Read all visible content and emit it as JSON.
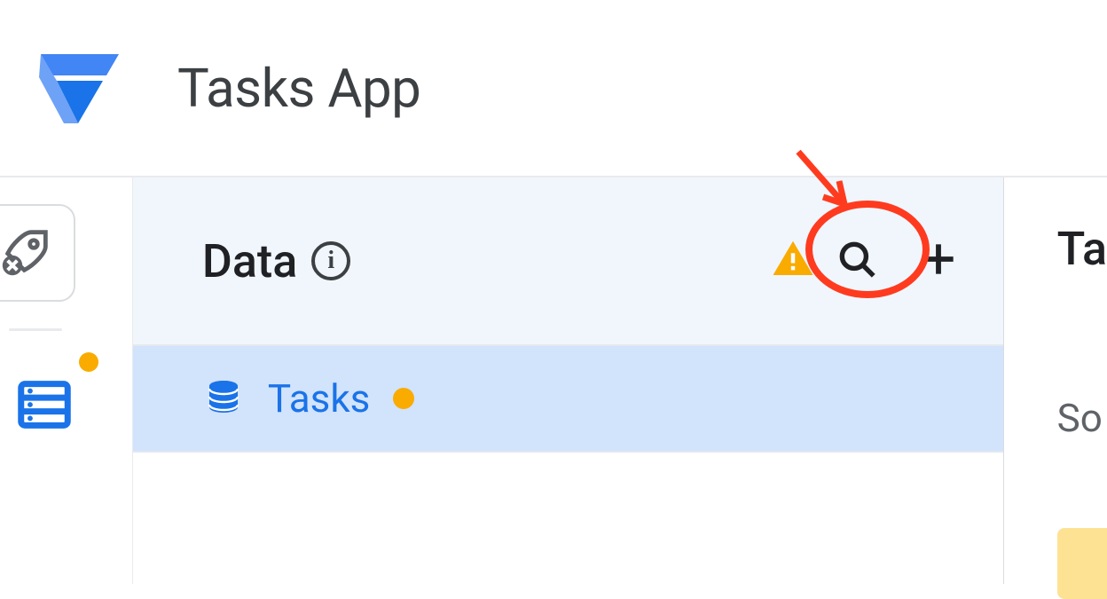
{
  "header": {
    "app_title": "Tasks App"
  },
  "rail": {
    "items": [
      {
        "name": "launch",
        "icon": "rocket-icon"
      },
      {
        "name": "data",
        "icon": "database-icon",
        "badge": true,
        "active": true
      }
    ]
  },
  "data_panel": {
    "title": "Data",
    "icons": {
      "info": "info-icon",
      "warning": "warning-icon",
      "search": "search-icon",
      "add": "plus-icon"
    },
    "tables": [
      {
        "label": "Tasks",
        "status": "warning"
      }
    ]
  },
  "right_panel": {
    "title_fragment": "Ta",
    "row_fragment": "So"
  },
  "colors": {
    "accent_blue": "#1a73e8",
    "warn_orange": "#f9ab00",
    "selection_blue": "#d2e3fc",
    "annotation_red": "#ff3b1f"
  }
}
